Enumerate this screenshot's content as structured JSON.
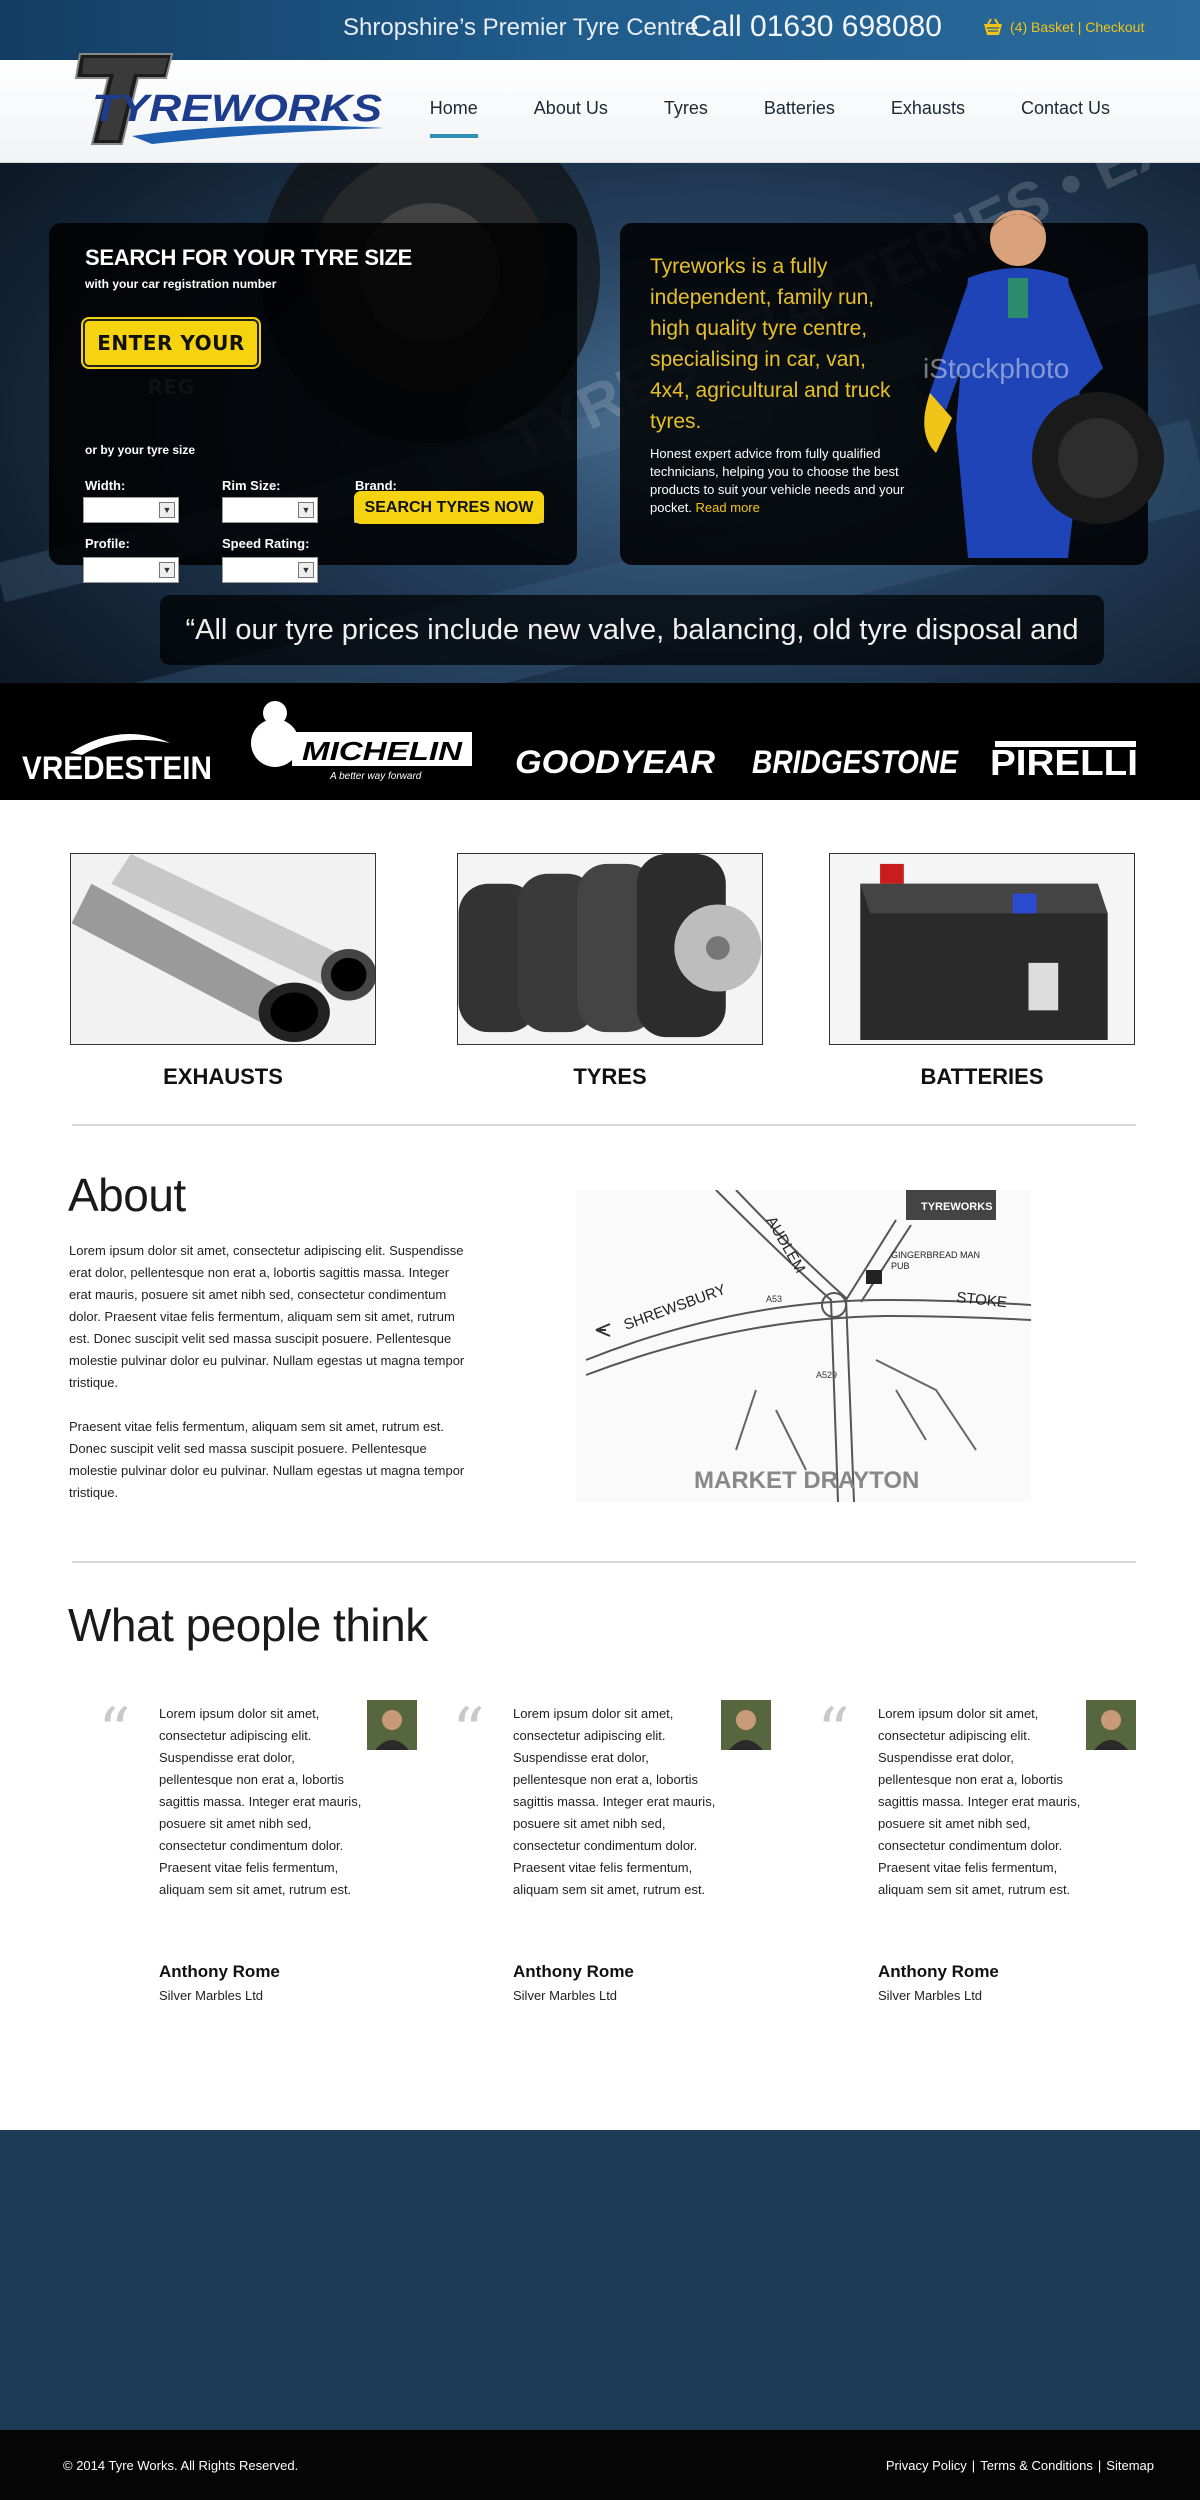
{
  "header": {
    "tagline": "Shropshire’s Premier Tyre Centre",
    "phone": "Call 01630 698080",
    "basket_label": "(4) Basket | Checkout"
  },
  "logo": {
    "text": "TYREWORKS"
  },
  "nav": {
    "items": [
      {
        "label": "Home",
        "active": true
      },
      {
        "label": "About Us"
      },
      {
        "label": "Tyres"
      },
      {
        "label": "Batteries"
      },
      {
        "label": "Exhausts"
      },
      {
        "label": "Contact Us"
      }
    ]
  },
  "search": {
    "title": "SEARCH FOR YOUR TYRE SIZE",
    "subtitle": "with your car registration number",
    "reg_button": "ENTER YOUR REG",
    "or_text": "or by your tyre size",
    "width_label": "Width:",
    "rim_label": "Rim Size:",
    "brand_label": "Brand:",
    "profile_label": "Profile:",
    "speed_label": "Speed Rating:",
    "search_button": "SEARCH TYRES NOW"
  },
  "intro": {
    "lead": "Tyreworks is a fully independent, family run, high quality tyre centre, specialising in car, van, 4x4, agricultural and truck tyres.",
    "body": "Honest expert advice from fully qualified technicians, helping you to choose the best products to suit your vehicle needs and your pocket.",
    "read_more": "Read more",
    "watermark": "iStockphoto"
  },
  "quote_banner": "“All our tyre prices include new valve, balancing, old tyre disposal and VAT”",
  "hero_watermark": "TYRES • BATTERIES • EXHAUSTS",
  "brands": {
    "vredestein": "VREDESTEIN",
    "michelin": "MICHELIN",
    "michelin_tagline": "A better way forward",
    "goodyear": "GOODYEAR",
    "bridgestone": "BRIDGESTONE",
    "pirelli": "PIRELLI"
  },
  "categories": [
    {
      "label": "EXHAUSTS"
    },
    {
      "label": "TYRES"
    },
    {
      "label": "BATTERIES"
    }
  ],
  "about": {
    "title": "About",
    "paragraph1": "Lorem ipsum dolor sit amet, consectetur adipiscing elit. Suspendisse erat dolor, pellentesque non erat a, lobortis sagittis massa. Integer erat mauris, posuere sit amet nibh sed, consectetur condimentum dolor. Praesent vitae felis fermentum, aliquam sem sit amet, rutrum est. Donec suscipit velit sed massa suscipit posuere. Pellentesque molestie pulvinar dolor eu pulvinar. Nullam egestas ut magna tempor tristique.",
    "paragraph2": "Praesent vitae felis fermentum, aliquam sem sit amet, rutrum est. Donec suscipit velit sed massa suscipit posuere. Pellentesque molestie pulvinar dolor eu pulvinar. Nullam egestas ut magna tempor tristique."
  },
  "map": {
    "town": "MARKET DRAYTON",
    "label_shrewsbury": "SHREWSBURY",
    "label_audlem": "AUDLEM",
    "label_stoke": "STOKE",
    "label_pub": "GINGERBREAD MAN PUB",
    "pub_line1": "GINGERBREAD MAN",
    "pub_line2": "PUB",
    "road_a53": "A53",
    "road_a529": "A529",
    "logo": "TYREWORKS"
  },
  "testimonials": {
    "title": "What people think",
    "items": [
      {
        "text": "Lorem ipsum dolor sit amet, consectetur adipiscing elit. Suspendisse erat dolor, pellentesque non erat a, lobortis sagittis massa. Integer erat mauris, posuere sit amet nibh sed, consectetur condimentum dolor. Praesent vitae felis fermentum, aliquam sem sit amet, rutrum est.",
        "name": "Anthony Rome",
        "company": "Silver Marbles Ltd"
      },
      {
        "text": "Lorem ipsum dolor sit amet, consectetur adipiscing elit. Suspendisse erat dolor, pellentesque non erat a, lobortis sagittis massa. Integer erat mauris, posuere sit amet nibh sed, consectetur condimentum dolor. Praesent vitae felis fermentum, aliquam sem sit amet, rutrum est.",
        "name": "Anthony Rome",
        "company": "Silver Marbles Ltd"
      },
      {
        "text": "Lorem ipsum dolor sit amet, consectetur adipiscing elit. Suspendisse erat dolor, pellentesque non erat a, lobortis sagittis massa. Integer erat mauris, posuere sit amet nibh sed, consectetur condimentum dolor. Praesent vitae felis fermentum, aliquam sem sit amet, rutrum est.",
        "name": "Anthony Rome",
        "company": "Silver Marbles Ltd"
      }
    ]
  },
  "footer": {
    "copyright": "© 2014 Tyre Works. All Rights Reserved.",
    "links": [
      "Privacy Policy",
      "Terms & Conditions",
      "Sitemap"
    ],
    "separator": "|"
  },
  "colors": {
    "accent_yellow": "#f5d40f",
    "nav_active": "#2f8fb5",
    "header_blue": "#1f5b8b",
    "footer_band": "#1d3a57"
  },
  "icons": [
    "basket-icon",
    "dropdown-arrow-icon",
    "quote-mark-icon"
  ]
}
